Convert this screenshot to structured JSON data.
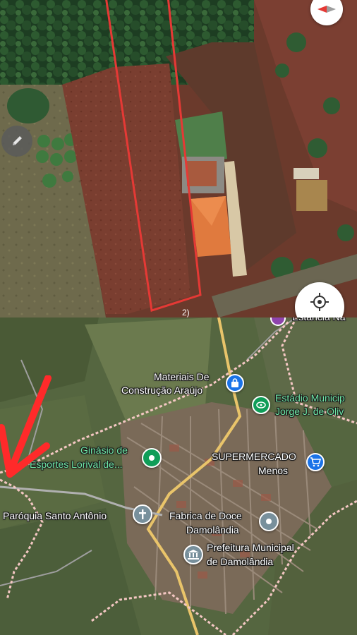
{
  "top_panel": {
    "scale_label": "2)",
    "buttons": {
      "compass": "compass-icon",
      "edit": "pencil-icon",
      "my_location": "crosshair-icon"
    },
    "colors": {
      "plot_outline": "#e53935",
      "soil": "#7a3e30",
      "roof": "#e07a3e"
    }
  },
  "bottom_panel": {
    "top_cut_label": "Estância Na",
    "pois": [
      {
        "id": "materiais",
        "line1": "Materiais De",
        "line2": "Construção Araújo",
        "icon": "shopping-bag-icon",
        "color": "#1a73e8",
        "style": "white"
      },
      {
        "id": "estadio",
        "line1": "Estádio Municip",
        "line2": "Jorge J. de Oliv",
        "icon": "stadium-icon",
        "color": "#0f9d58",
        "style": "green"
      },
      {
        "id": "ginasio",
        "line1": "Ginásio de",
        "line2": "Esportes Lorival de...",
        "icon": "pin-dot-icon",
        "color": "#0f9d58",
        "style": "green"
      },
      {
        "id": "supermercado",
        "line1": "SUPERMERCADO",
        "line2": "Menos",
        "icon": "cart-icon",
        "color": "#1a73e8",
        "style": "white"
      },
      {
        "id": "paroquia",
        "line1": "Paróquia Santo Antônio",
        "line2": "",
        "icon": "cross-icon",
        "color": "#78909c",
        "style": "white"
      },
      {
        "id": "fabrica",
        "line1": "Fabrica de Doce",
        "line2": "Damolândia",
        "icon": "pin-dot-icon",
        "color": "#78909c",
        "style": "white"
      },
      {
        "id": "prefeitura",
        "line1": "Prefeitura Municipal",
        "line2": "de Damolândia",
        "icon": "government-icon",
        "color": "#78909c",
        "style": "white"
      }
    ],
    "annotation": {
      "icon": "red-arrow-icon",
      "color": "#ff2a2a"
    },
    "boundary_color": "#f4c7c3"
  }
}
